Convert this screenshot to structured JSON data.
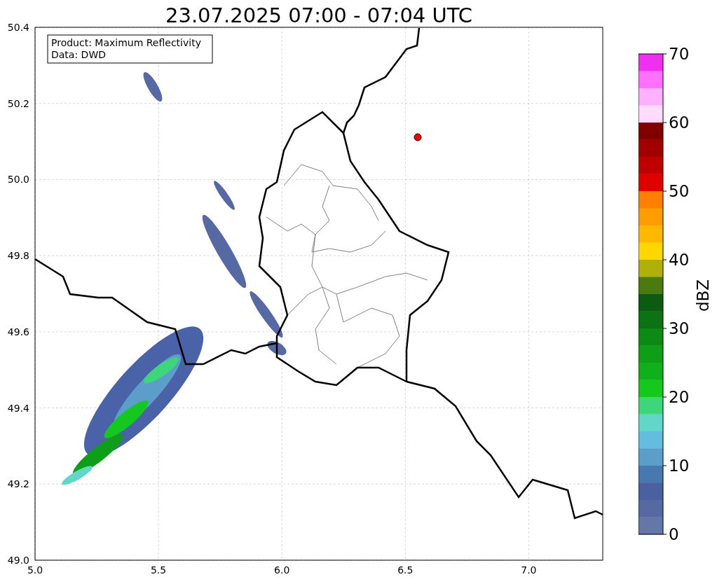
{
  "title": "23.07.2025 07:00 - 07:04 UTC",
  "map": {
    "info_box": [
      "Product: Maximum Reflectivity",
      "Data: DWD"
    ],
    "x_ticks": [
      "5.0",
      "5.5",
      "6.0",
      "6.5",
      "7.0"
    ],
    "y_ticks": [
      "50.4",
      "50.2",
      "50.0",
      "49.8",
      "49.6",
      "49.4",
      "49.2",
      "49.0"
    ]
  },
  "colorbar": {
    "label": "dBZ",
    "ticks": [
      "70",
      "60",
      "50",
      "40",
      "30",
      "20",
      "10",
      "0"
    ],
    "bands": [
      {
        "color": "#f030f0"
      },
      {
        "color": "#ff70ff"
      },
      {
        "color": "#ffb0ff"
      },
      {
        "color": "#ffdcff"
      },
      {
        "color": "#800000"
      },
      {
        "color": "#a00000"
      },
      {
        "color": "#c00000"
      },
      {
        "color": "#e00000"
      },
      {
        "color": "#ff7f00"
      },
      {
        "color": "#ff9c00"
      },
      {
        "color": "#ffb800"
      },
      {
        "color": "#ffd700"
      },
      {
        "color": "#b0b00a"
      },
      {
        "color": "#4a7a10"
      },
      {
        "color": "#0b5c12"
      },
      {
        "color": "#0c7214"
      },
      {
        "color": "#0d8a16"
      },
      {
        "color": "#0f9e18"
      },
      {
        "color": "#10b01a"
      },
      {
        "color": "#14c81e"
      },
      {
        "color": "#3dd67a"
      },
      {
        "color": "#62d6c8"
      },
      {
        "color": "#63bde0"
      },
      {
        "color": "#5b9ec9"
      },
      {
        "color": "#4878b0"
      },
      {
        "color": "#4a60a0"
      },
      {
        "color": "#5769a3"
      },
      {
        "color": "#6577a8"
      }
    ]
  }
}
